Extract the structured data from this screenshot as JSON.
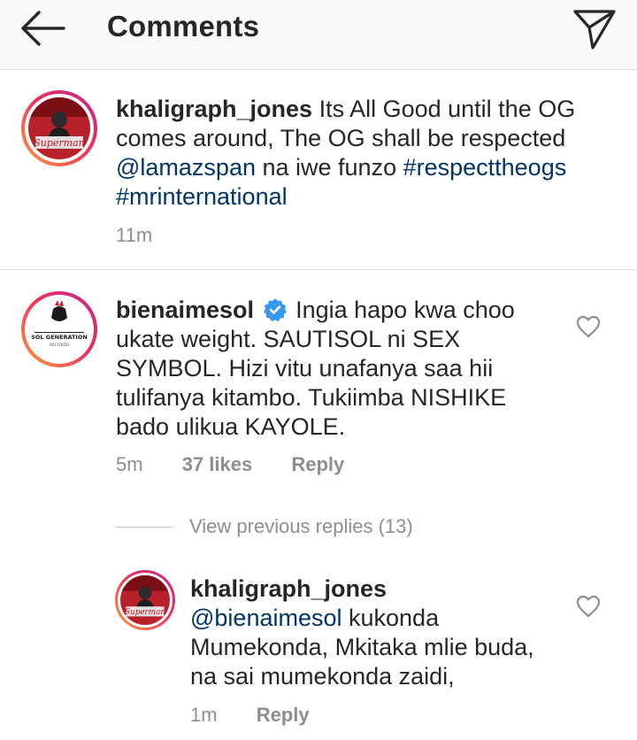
{
  "header": {
    "title": "Comments",
    "back_icon": "arrow-left-icon",
    "share_icon": "paper-plane-icon"
  },
  "caption": {
    "username": "khaligraph_jones",
    "text_1": " Its All Good until the OG comes around,  The OG shall be respected ",
    "mention": "@lamazspan",
    "text_2": " na iwe funzo ",
    "tag_1": "#respecttheogs",
    "tag_2": "#mrinternational",
    "time": "11m"
  },
  "comment": {
    "username": "bienaimesol",
    "verified_icon": "verified-badge-icon",
    "text": " Ingia hapo kwa choo ukate weight. SAUTISOL ni SEX SYMBOL. Hizi vitu unafanya saa hii tulifanya kitambo. Tukiimba NISHIKE bado ulikua KAYOLE.",
    "time": "5m",
    "likes": "37 likes",
    "reply": "Reply",
    "avatar_text": "SOL GENERATION",
    "avatar_subtext": "RECORDS"
  },
  "view_previous": "View previous replies (13)",
  "reply": {
    "username": "khaligraph_jones",
    "mention": "@bienaimesol",
    "text": " kukonda Mumekonda, Mkitaka mlie buda, na sai mumekonda zaidi,",
    "time": "1m",
    "reply": "Reply"
  },
  "avatar_khaligraph_text": "Superman",
  "colors": {
    "link": "#003569",
    "muted": "#8e8e8e",
    "verified": "#3897f0",
    "ring_start": "#f9a13c",
    "ring_end": "#c2278f"
  }
}
